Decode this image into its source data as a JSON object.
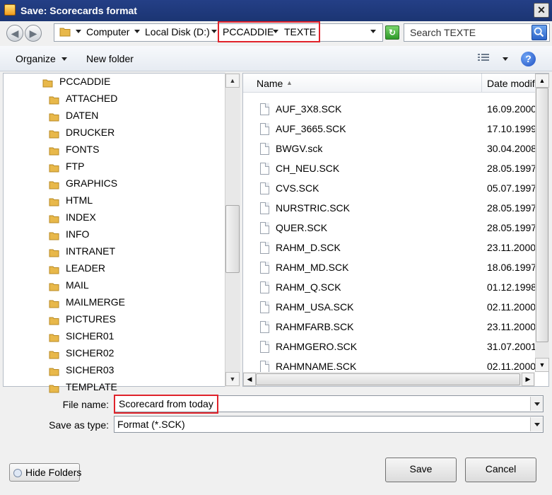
{
  "window": {
    "title": "Save: Scorecards format",
    "close_glyph": "✕"
  },
  "address": {
    "segments": [
      "Computer",
      "Local Disk (D:)",
      "PCCADDIE",
      "TEXTE"
    ],
    "search_placeholder": "Search TEXTE"
  },
  "toolbar": {
    "organize_label": "Organize",
    "new_folder_label": "New folder",
    "help_glyph": "?"
  },
  "tree": {
    "root": "PCCADDIE",
    "items": [
      "ATTACHED",
      "DATEN",
      "DRUCKER",
      "FONTS",
      "FTP",
      "GRAPHICS",
      "HTML",
      "INDEX",
      "INFO",
      "INTRANET",
      "LEADER",
      "MAIL",
      "MAILMERGE",
      "PICTURES",
      "SICHER01",
      "SICHER02",
      "SICHER03",
      "TEMPLATE"
    ]
  },
  "list": {
    "columns": {
      "name": "Name",
      "date": "Date modified"
    },
    "files": [
      {
        "name": "AUF_3X8.SCK",
        "date": "16.09.2000"
      },
      {
        "name": "AUF_3665.SCK",
        "date": "17.10.1999"
      },
      {
        "name": "BWGV.sck",
        "date": "30.04.2008"
      },
      {
        "name": "CH_NEU.SCK",
        "date": "28.05.1997"
      },
      {
        "name": "CVS.SCK",
        "date": "05.07.1997"
      },
      {
        "name": "NURSTRIC.SCK",
        "date": "28.05.1997"
      },
      {
        "name": "QUER.SCK",
        "date": "28.05.1997"
      },
      {
        "name": "RAHM_D.SCK",
        "date": "23.11.2000"
      },
      {
        "name": "RAHM_MD.SCK",
        "date": "18.06.1997"
      },
      {
        "name": "RAHM_Q.SCK",
        "date": "01.12.1998"
      },
      {
        "name": "RAHM_USA.SCK",
        "date": "02.11.2000"
      },
      {
        "name": "RAHMFARB.SCK",
        "date": "23.11.2000"
      },
      {
        "name": "RAHMGERO.SCK",
        "date": "31.07.2001"
      },
      {
        "name": "RAHMNAME.SCK",
        "date": "02.11.2000"
      }
    ]
  },
  "form": {
    "filename_label": "File name:",
    "filename_value": "Scorecard from today",
    "type_label": "Save as type:",
    "type_value": "Format (*.SCK)"
  },
  "buttons": {
    "hide_folders": "Hide Folders",
    "save": "Save",
    "cancel": "Cancel"
  },
  "colors": {
    "highlight": "#e0232b",
    "titlebar": "#1f3a7d",
    "folder": "#e8b84a"
  }
}
